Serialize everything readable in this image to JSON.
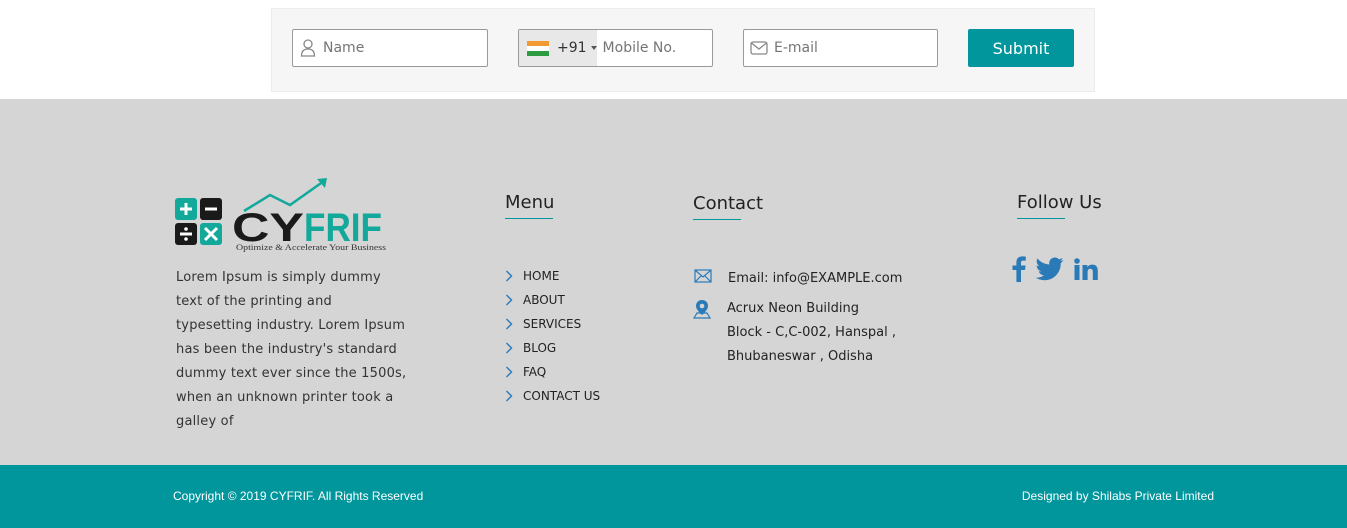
{
  "form": {
    "name_placeholder": "Name",
    "dial_code": "+91",
    "mobile_placeholder": "Mobile No.",
    "email_placeholder": "E-mail",
    "submit_label": "Submit"
  },
  "logo": {
    "brand": "CYFRIF",
    "tagline": "Optimize & Accelerate Your Business"
  },
  "about": "Lorem Ipsum is simply dummy text of the printing and typesetting industry. Lorem Ipsum has been the industry's standard dummy text ever since the 1500s, when an unknown printer took a galley of",
  "menu": {
    "title": "Menu",
    "items": [
      "HOME",
      "ABOUT",
      "SERVICES",
      "BLOG",
      "FAQ",
      "CONTACT US"
    ]
  },
  "contact": {
    "title": "Contact",
    "email": "Email: info@EXAMPLE.com",
    "address": [
      "Acrux Neon Building",
      "Block - C,C-002, Hanspal ,",
      "Bhubaneswar , Odisha"
    ]
  },
  "follow": {
    "title": "Follow Us",
    "icons": [
      "facebook-icon",
      "twitter-icon",
      "linkedin-icon"
    ]
  },
  "copyright": "Copyright © 2019  CYFRIF. All Rights Reserved",
  "designed_by": "Designed by Shilabs Private Limited",
  "colors": {
    "accent": "#00969c",
    "footer_bg": "#d5d5d5",
    "icon_blue": "#2a7ab8"
  }
}
